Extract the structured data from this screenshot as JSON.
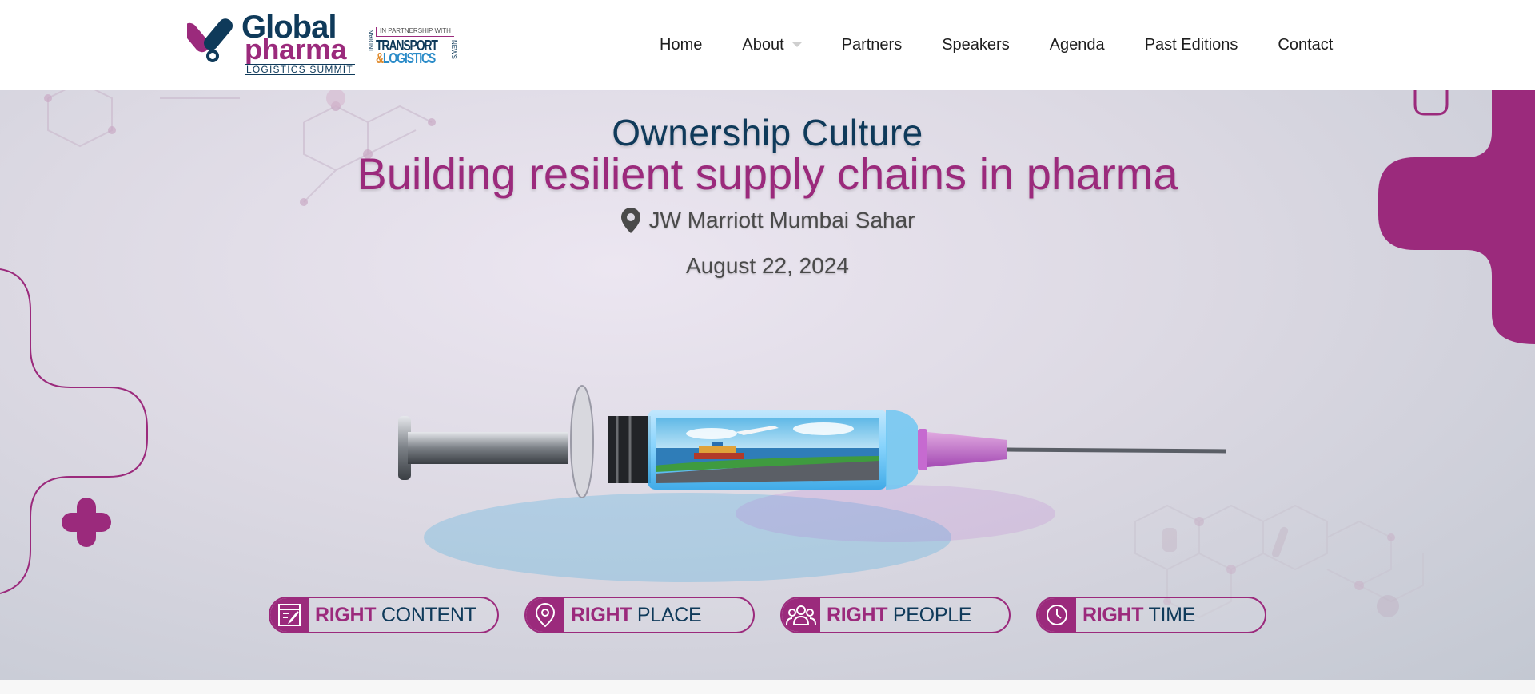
{
  "header": {
    "logo": {
      "word1": "Global",
      "word2": "pharma",
      "word3": "LOGISTICS SUMMIT",
      "partner_prefix": "IN PARTNERSHIP WITH",
      "partner_indian": "INDIAN",
      "partner_line1": "TRANSPORT",
      "partner_amp": "&",
      "partner_line2": "LOGISTICS",
      "partner_news": "NEWS"
    },
    "nav": [
      {
        "label": "Home"
      },
      {
        "label": "About",
        "has_dropdown": true
      },
      {
        "label": "Partners"
      },
      {
        "label": "Speakers"
      },
      {
        "label": "Agenda"
      },
      {
        "label": "Past Editions"
      },
      {
        "label": "Contact"
      }
    ]
  },
  "hero": {
    "subtitle": "Ownership Culture",
    "title": "Building resilient supply chains in pharma",
    "venue": "JW Marriott Mumbai Sahar",
    "venue_icon": "map-pin-icon",
    "date": "August 22, 2024",
    "pills": [
      {
        "strong": "RIGHT",
        "rest": " CONTENT",
        "icon": "notepad-icon"
      },
      {
        "strong": "RIGHT",
        "rest": " PLACE",
        "icon": "map-pin-icon"
      },
      {
        "strong": "RIGHT",
        "rest": " PEOPLE",
        "icon": "people-icon"
      },
      {
        "strong": "RIGHT",
        "rest": " TIME",
        "icon": "clock-icon"
      }
    ]
  },
  "colors": {
    "brand_magenta": "#9b2a7c",
    "brand_navy": "#0f3a5a",
    "text_gray": "#4a4a4a"
  }
}
